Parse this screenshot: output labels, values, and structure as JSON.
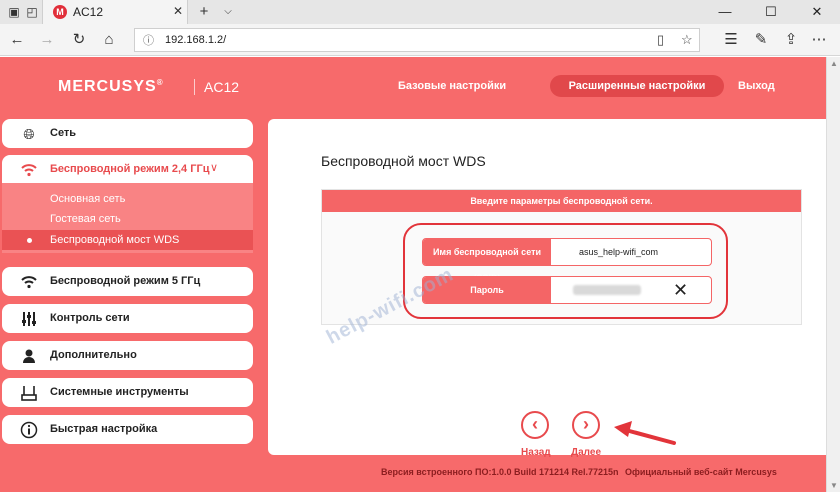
{
  "browser": {
    "tab_title": "AC12",
    "tab_logo": "M",
    "url": "192.168.1.2/",
    "icons": {
      "tab_overview": "tab-overview-icon",
      "back_tabs": "back-tabs-icon",
      "new_tab": "plus-icon",
      "tab_list": "chevron-down-icon",
      "back": "arrow-left-icon",
      "forward": "arrow-right-icon",
      "refresh": "refresh-icon",
      "home": "home-icon",
      "info": "info-icon",
      "reading": "reading-view-icon",
      "favorite": "star-icon",
      "favorites_hub": "favorites-hub-icon",
      "notes": "pen-icon",
      "share": "share-icon",
      "more": "more-icon"
    }
  },
  "router": {
    "brand": "MERCUSYS",
    "brand_mark": "®",
    "model": "AC12",
    "nav": {
      "basic": "Базовые настройки",
      "advanced": "Расширенные настройки",
      "logout": "Выход"
    }
  },
  "sidebar": {
    "items": [
      {
        "label": "Сеть",
        "icon": "globe-icon"
      },
      {
        "label": "Беспроводной режим 2,4 ГГц",
        "icon": "wifi-icon"
      },
      {
        "label": "Беспроводной режим 5 ГГц",
        "icon": "wifi-icon"
      },
      {
        "label": "Контроль сети",
        "icon": "sliders-icon"
      },
      {
        "label": "Дополнительно",
        "icon": "user-icon"
      },
      {
        "label": "Системные инструменты",
        "icon": "router-icon"
      },
      {
        "label": "Быстрая настройка",
        "icon": "info-icon"
      }
    ],
    "submenu": [
      {
        "label": "Основная сеть"
      },
      {
        "label": "Гостевая сеть"
      },
      {
        "label": "Беспроводной мост WDS"
      }
    ]
  },
  "content": {
    "title": "Беспроводной мост WDS",
    "form_header": "Введите параметры беспроводной сети.",
    "ssid_label": "Имя беспроводной сети (SSID)",
    "ssid_value": "asus_help-wifi_com",
    "password_label": "Пароль",
    "back_label": "Назад",
    "next_label": "Далее"
  },
  "watermark": "help-wifi.com",
  "footer": {
    "firmware": "Версия встроенного ПО:1.0.0 Build 171214 Rel.77215n",
    "site": "Официальный веб-сайт Mercusys"
  },
  "colors": {
    "brand_red": "#f76a6b",
    "accent": "#e84a4d",
    "annotation": "#e2343a"
  }
}
